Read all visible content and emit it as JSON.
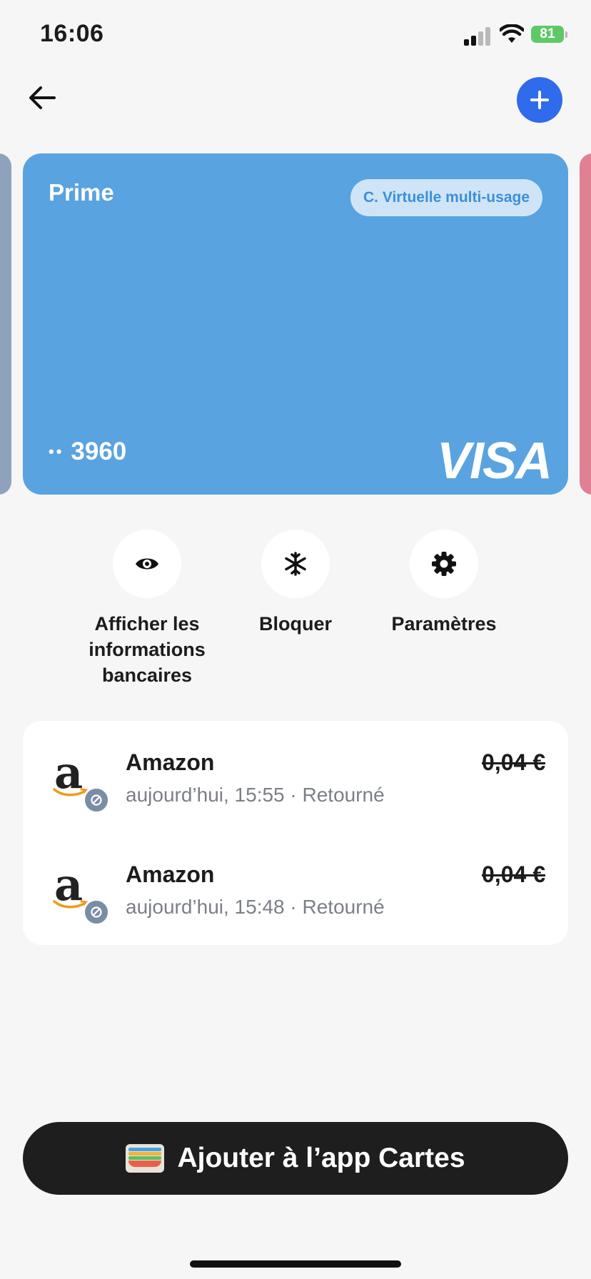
{
  "status_bar": {
    "time": "16:06",
    "battery": "81"
  },
  "header": {
    "back_icon": "arrow-left-icon",
    "add_icon": "plus-icon",
    "accent_color": "#2f6bea"
  },
  "card": {
    "name": "Prime",
    "type_badge": "C. Virtuelle multi-usage",
    "number_mask": "••",
    "last_digits": "3960",
    "network": "VISA",
    "color": "#59a3e0",
    "peek_left_color": "#8fa2bd",
    "peek_right_color": "#e17f93"
  },
  "actions": [
    {
      "label": "Afficher les informations bancaires",
      "icon": "eye-icon"
    },
    {
      "label": "Bloquer",
      "icon": "snowflake-icon"
    },
    {
      "label": "Paramètres",
      "icon": "gear-icon"
    }
  ],
  "transactions": [
    {
      "merchant": "Amazon",
      "meta": "aujourd’hui, 15:55 · Retourné",
      "amount": "0,04 €",
      "status_icon": "blocked-icon"
    },
    {
      "merchant": "Amazon",
      "meta": "aujourd’hui, 15:48 · Retourné",
      "amount": "0,04 €",
      "status_icon": "blocked-icon"
    }
  ],
  "wallet_button": {
    "label": "Ajouter à l’app Cartes",
    "icon": "wallet-icon"
  }
}
